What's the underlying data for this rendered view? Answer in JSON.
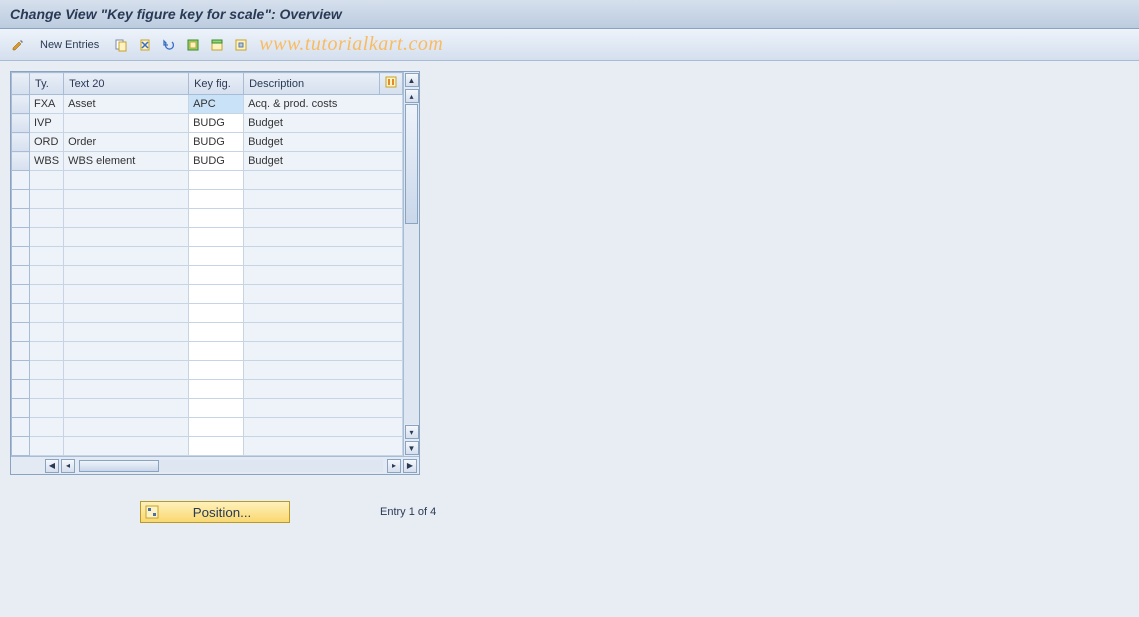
{
  "title": "Change View \"Key figure key for scale\": Overview",
  "toolbar": {
    "new_entries": "New Entries"
  },
  "watermark": "www.tutorialkart.com",
  "columns": {
    "ty": "Ty.",
    "text20": "Text 20",
    "keyfig": "Key fig.",
    "desc": "Description"
  },
  "rows": [
    {
      "ty": "FXA",
      "text20": "Asset",
      "keyfig": "APC",
      "desc": "Acq. & prod. costs",
      "sel": true
    },
    {
      "ty": "IVP",
      "text20": "",
      "keyfig": "BUDG",
      "desc": "Budget"
    },
    {
      "ty": "ORD",
      "text20": "Order",
      "keyfig": "BUDG",
      "desc": "Budget"
    },
    {
      "ty": "WBS",
      "text20": "WBS element",
      "keyfig": "BUDG",
      "desc": "Budget"
    }
  ],
  "empty_row_count": 15,
  "footer": {
    "position": "Position...",
    "entry": "Entry 1 of 4"
  }
}
